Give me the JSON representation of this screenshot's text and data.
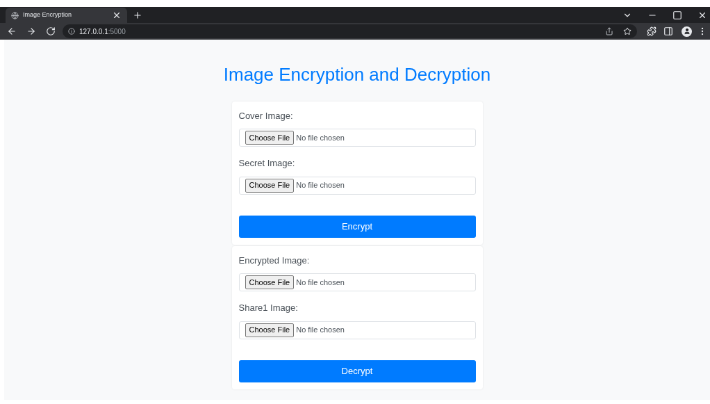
{
  "browser": {
    "tab": {
      "title": "Image Encryption",
      "selected": true
    },
    "address": {
      "host": "127.0.0.1",
      "port": ":5000"
    }
  },
  "page": {
    "title": "Image Encryption and Decryption",
    "cards": [
      {
        "fields": [
          {
            "label": "Cover Image:",
            "button": "Choose File",
            "status": "No file chosen"
          },
          {
            "label": "Secret Image:",
            "button": "Choose File",
            "status": "No file chosen"
          }
        ],
        "action": "Encrypt"
      },
      {
        "fields": [
          {
            "label": "Encrypted Image:",
            "button": "Choose File",
            "status": "No file chosen"
          },
          {
            "label": "Share1 Image:",
            "button": "Choose File",
            "status": "No file chosen"
          }
        ],
        "action": "Decrypt"
      }
    ]
  }
}
